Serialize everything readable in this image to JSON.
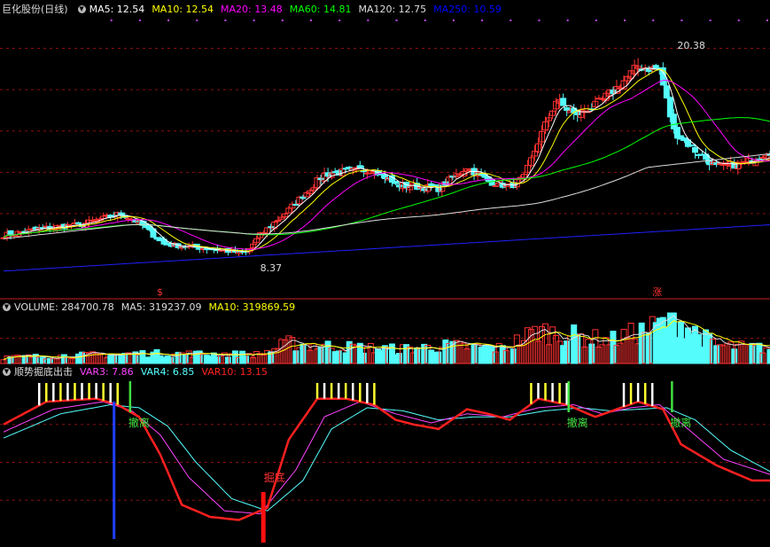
{
  "header": {
    "price": {
      "icon": "chevron-down-icon",
      "title": "巨化股份(日线)",
      "items": [
        {
          "label": "MA5: 12.54",
          "color": "#ffffff"
        },
        {
          "label": "MA10: 12.54",
          "color": "#ffff00"
        },
        {
          "label": "MA20: 13.48",
          "color": "#ff00ff"
        },
        {
          "label": "MA60: 14.81",
          "color": "#00ff00"
        },
        {
          "label": "MA120: 12.75",
          "color": "#dddddd"
        },
        {
          "label": "MA250: 10.59",
          "color": "#0000ff"
        }
      ]
    },
    "volume": {
      "icon": "chevron-down-icon",
      "items": [
        {
          "label": "VOLUME: 284700.78",
          "color": "#dddddd"
        },
        {
          "label": "MA5: 319237.09",
          "color": "#dddddd"
        },
        {
          "label": "MA10: 319869.59",
          "color": "#ffff00"
        }
      ]
    },
    "indicator": {
      "icon": "chevron-down-icon",
      "title": "顺势掘底出击",
      "items": [
        {
          "label": "VAR3: 7.86",
          "color": "#ff44ff"
        },
        {
          "label": "VAR4: 6.85",
          "color": "#55ffff"
        },
        {
          "label": "VAR10: 13.15",
          "color": "#ff2222"
        }
      ]
    }
  },
  "chart_data": [
    {
      "type": "candlestick",
      "name": "price",
      "up_color": "#ff3232",
      "down_color": "#54fcfc",
      "price_range": [
        7.0,
        22.0
      ],
      "high_annotation": {
        "value": 20.38,
        "label": "20.38"
      },
      "low_annotation": {
        "value": 8.37,
        "label": "8.37"
      },
      "markers": [
        {
          "bar": 44,
          "label": "$",
          "color": "#ff3232"
        },
        {
          "bar": 183,
          "label": "涨",
          "color": "#ff3232"
        }
      ],
      "anchors": [
        [
          0,
          9.8
        ],
        [
          12,
          10.2
        ],
        [
          22,
          10.4
        ],
        [
          33,
          11.0
        ],
        [
          38,
          10.5
        ],
        [
          45,
          9.3
        ],
        [
          55,
          9.1
        ],
        [
          68,
          8.8
        ],
        [
          72,
          9.8
        ],
        [
          80,
          11.2
        ],
        [
          90,
          13.2
        ],
        [
          104,
          13.5
        ],
        [
          110,
          12.6
        ],
        [
          122,
          12.4
        ],
        [
          130,
          13.6
        ],
        [
          136,
          12.8
        ],
        [
          142,
          12.5
        ],
        [
          146,
          13.0
        ],
        [
          150,
          15.0
        ],
        [
          155,
          17.3
        ],
        [
          160,
          16.5
        ],
        [
          166,
          17.0
        ],
        [
          172,
          18.0
        ],
        [
          178,
          19.2
        ],
        [
          184,
          19.0
        ],
        [
          188,
          15.6
        ],
        [
          194,
          14.5
        ],
        [
          200,
          13.6
        ],
        [
          208,
          13.8
        ],
        [
          215,
          14.5
        ]
      ],
      "gridlines": [
        11,
        13.3,
        15.6,
        17.9,
        20.2
      ]
    },
    {
      "type": "bar",
      "name": "volume",
      "anchors": [
        [
          0,
          0.12
        ],
        [
          40,
          0.2
        ],
        [
          72,
          0.18
        ],
        [
          80,
          0.4
        ],
        [
          90,
          0.35
        ],
        [
          110,
          0.28
        ],
        [
          125,
          0.35
        ],
        [
          140,
          0.3
        ],
        [
          150,
          0.65
        ],
        [
          160,
          0.55
        ],
        [
          170,
          0.45
        ],
        [
          182,
          0.7
        ],
        [
          188,
          0.9
        ],
        [
          200,
          0.35
        ],
        [
          215,
          0.3
        ]
      ],
      "gridlines": [
        0.5
      ]
    },
    {
      "type": "line",
      "name": "indicator",
      "ylim": [
        0,
        100
      ],
      "series": [
        {
          "name": "VAR10",
          "color": "#ff2020",
          "anchors": [
            [
              0,
              75
            ],
            [
              12,
              90
            ],
            [
              26,
              92
            ],
            [
              32,
              88
            ],
            [
              38,
              80
            ],
            [
              44,
              55
            ],
            [
              50,
              22
            ],
            [
              58,
              14
            ],
            [
              66,
              12
            ],
            [
              74,
              20
            ],
            [
              80,
              65
            ],
            [
              88,
              92
            ],
            [
              96,
              92
            ],
            [
              104,
              88
            ],
            [
              110,
              78
            ],
            [
              115,
              75
            ],
            [
              122,
              72
            ],
            [
              130,
              85
            ],
            [
              136,
              82
            ],
            [
              142,
              78
            ],
            [
              150,
              92
            ],
            [
              158,
              88
            ],
            [
              166,
              80
            ],
            [
              172,
              85
            ],
            [
              178,
              90
            ],
            [
              185,
              85
            ],
            [
              190,
              62
            ],
            [
              200,
              48
            ],
            [
              210,
              38
            ],
            [
              215,
              38
            ]
          ]
        },
        {
          "name": "VAR3",
          "color": "#ff44ff",
          "anchors": [
            [
              0,
              70
            ],
            [
              14,
              85
            ],
            [
              28,
              90
            ],
            [
              36,
              84
            ],
            [
              44,
              68
            ],
            [
              52,
              40
            ],
            [
              62,
              18
            ],
            [
              72,
              16
            ],
            [
              82,
              45
            ],
            [
              90,
              80
            ],
            [
              100,
              90
            ],
            [
              110,
              82
            ],
            [
              120,
              76
            ],
            [
              130,
              82
            ],
            [
              140,
              80
            ],
            [
              150,
              86
            ],
            [
              160,
              88
            ],
            [
              168,
              82
            ],
            [
              176,
              86
            ],
            [
              184,
              88
            ],
            [
              192,
              72
            ],
            [
              202,
              52
            ],
            [
              215,
              42
            ]
          ]
        },
        {
          "name": "VAR4",
          "color": "#55ffff",
          "anchors": [
            [
              0,
              66
            ],
            [
              16,
              82
            ],
            [
              30,
              88
            ],
            [
              38,
              86
            ],
            [
              46,
              74
            ],
            [
              54,
              50
            ],
            [
              64,
              26
            ],
            [
              74,
              18
            ],
            [
              84,
              38
            ],
            [
              92,
              72
            ],
            [
              102,
              86
            ],
            [
              112,
              84
            ],
            [
              122,
              78
            ],
            [
              132,
              80
            ],
            [
              142,
              80
            ],
            [
              152,
              84
            ],
            [
              162,
              86
            ],
            [
              170,
              84
            ],
            [
              178,
              85
            ],
            [
              186,
              86
            ],
            [
              194,
              78
            ],
            [
              204,
              58
            ],
            [
              215,
              44
            ]
          ]
        }
      ],
      "signals": [
        {
          "label": "撤离",
          "bar": 37
        },
        {
          "label": "掘底",
          "bar": 73
        },
        {
          "label": "撤离",
          "bar": 160
        },
        {
          "label": "撤离",
          "bar": 189
        }
      ],
      "gridlines": [
        75,
        50,
        25
      ]
    }
  ]
}
